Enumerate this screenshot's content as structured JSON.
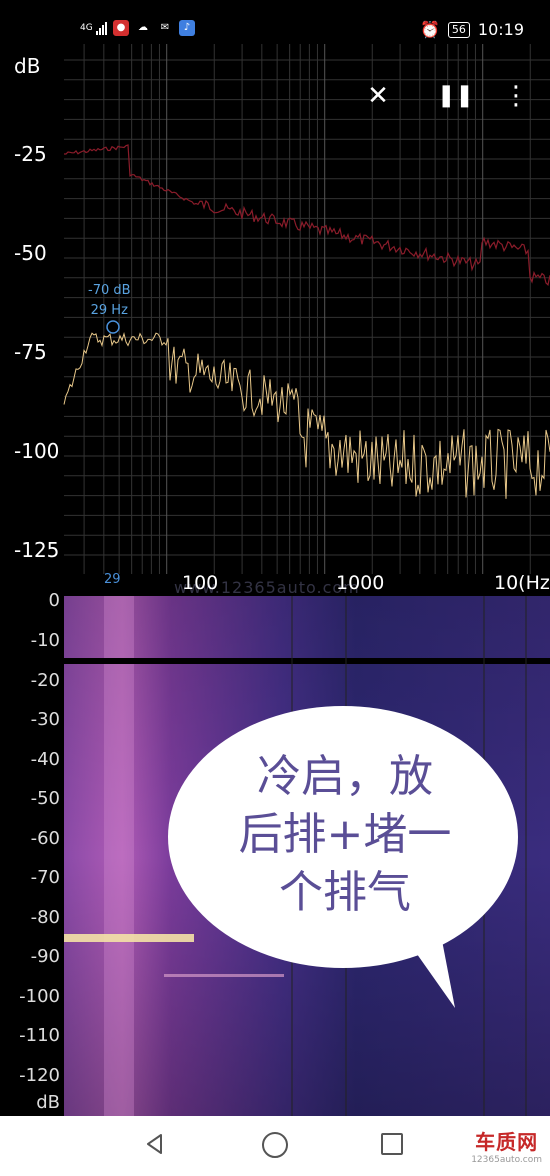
{
  "status_bar": {
    "network": "4G",
    "time": "10:19",
    "battery": "56",
    "app_icons": [
      "mic-icon",
      "swirl-icon",
      "mail-icon",
      "music-icon"
    ]
  },
  "toolbar": {
    "close_icon": "✕",
    "pause_icon": "❚❚",
    "menu_icon": "⋮"
  },
  "spectrum": {
    "y_unit": "dB",
    "y_ticks": [
      "-25",
      "-50",
      "-75",
      "-100",
      "-125"
    ],
    "x_ticks": [
      "100",
      "1000",
      "10(Hz"
    ],
    "peak_marker": {
      "db": "-70 dB",
      "hz": "29 Hz",
      "x_label": "29"
    },
    "watermark": "www.12365auto.com",
    "colors": {
      "upper_trace": "#8a1c2a",
      "lower_trace": "#e8c88a",
      "grid": "#333333",
      "marker": "#4a90d9"
    }
  },
  "spectrogram": {
    "y_unit": "dB",
    "y_ticks": [
      "0",
      "-10",
      "-20",
      "-30",
      "-40",
      "-50",
      "-60",
      "-70",
      "-80",
      "-90",
      "-100",
      "-110",
      "-120"
    ]
  },
  "annotation": {
    "lines": [
      "冷启，放",
      "后排+堵一",
      "个排气"
    ]
  },
  "nav_bar": {
    "logo_main": "车质网",
    "logo_sub": "12365auto.com"
  }
}
